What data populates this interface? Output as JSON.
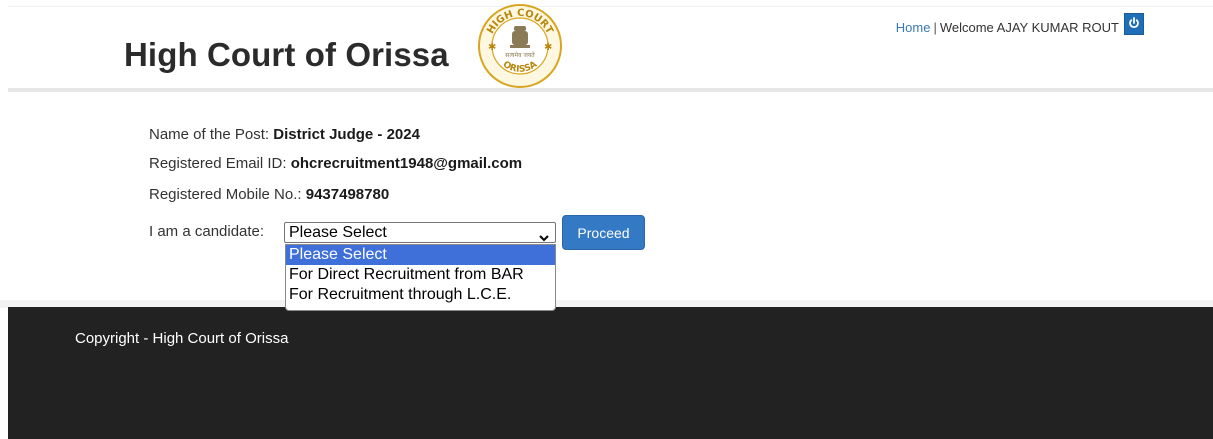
{
  "header": {
    "brand": "High Court of Orissa",
    "emblem_text_top": "HIGH COURT",
    "emblem_text_bottom": "ORISSA",
    "emblem_motto": "सत्यमेव जयते"
  },
  "topnav": {
    "home_label": "Home",
    "separator": "|",
    "welcome_text": "Welcome AJAY KUMAR ROUT",
    "power_icon": "power-icon"
  },
  "info": {
    "post_label": "Name of the Post:",
    "post_value": "District Judge - 2024",
    "email_label": "Registered Email ID:",
    "email_value": "ohcrecruitment1948@gmail.com",
    "mobile_label": "Registered Mobile No.:",
    "mobile_value": "9437498780"
  },
  "form": {
    "candidate_label": "I am a candidate:",
    "select_value": "Please Select",
    "options": [
      "Please Select",
      "For Direct Recruitment from BAR",
      "For Recruitment through L.C.E."
    ],
    "proceed_label": "Proceed"
  },
  "footer": {
    "copyright": "Copyright - High Court of Orissa"
  },
  "colors": {
    "accent": "#3379c4",
    "footer_bg": "#222222",
    "selected_option": "#3f6fd8",
    "link": "#3a78b8"
  }
}
